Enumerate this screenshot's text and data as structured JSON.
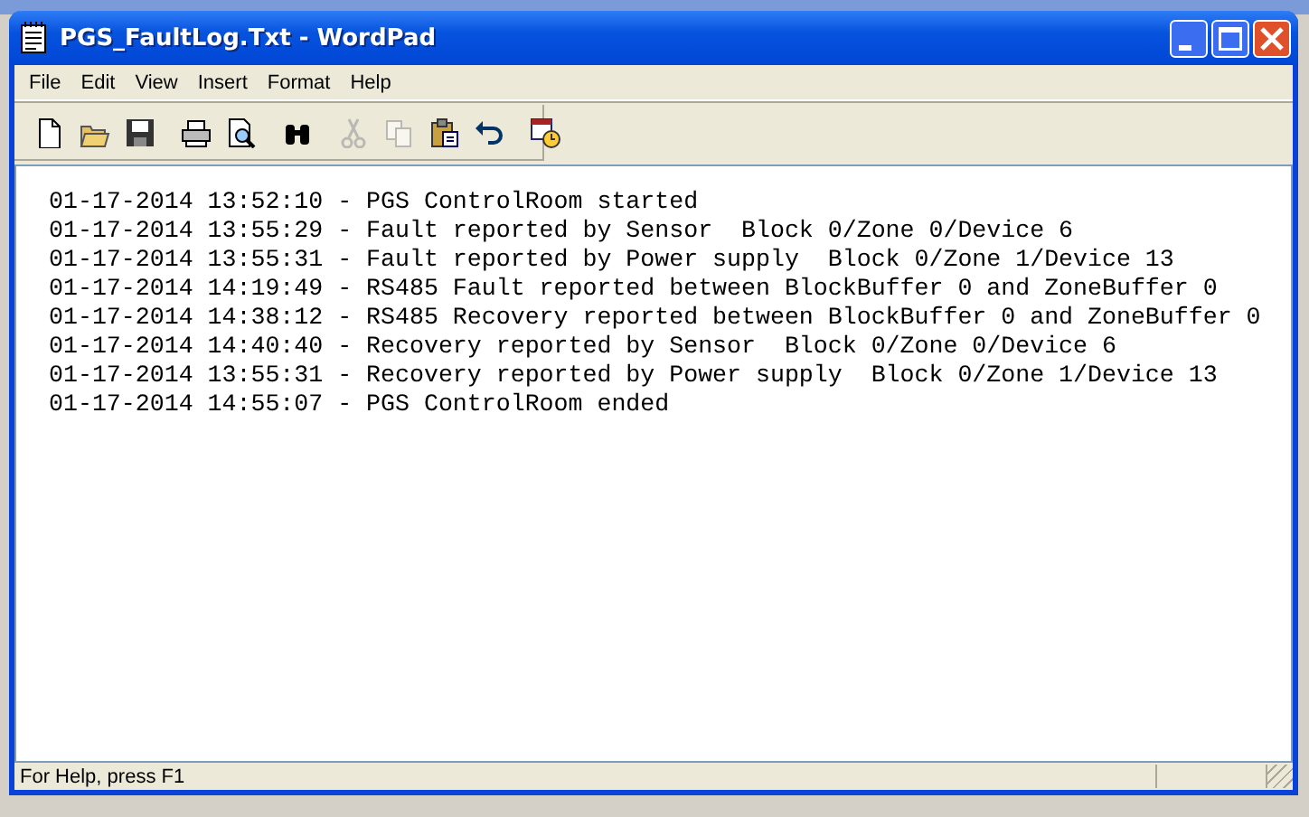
{
  "window": {
    "title": "PGS_FaultLog.Txt - WordPad"
  },
  "menu": [
    "File",
    "Edit",
    "View",
    "Insert",
    "Format",
    "Help"
  ],
  "toolbar": [
    {
      "kind": "new",
      "disabled": false
    },
    {
      "kind": "open",
      "disabled": false
    },
    {
      "kind": "save",
      "disabled": false
    },
    {
      "kind": "sep"
    },
    {
      "kind": "print",
      "disabled": false
    },
    {
      "kind": "preview",
      "disabled": false
    },
    {
      "kind": "sep"
    },
    {
      "kind": "find",
      "disabled": false
    },
    {
      "kind": "sep"
    },
    {
      "kind": "cut",
      "disabled": true
    },
    {
      "kind": "copy",
      "disabled": true
    },
    {
      "kind": "paste",
      "disabled": false
    },
    {
      "kind": "undo",
      "disabled": false
    },
    {
      "kind": "sep"
    },
    {
      "kind": "datetime",
      "disabled": false
    }
  ],
  "document": {
    "lines": [
      "01-17-2014 13:52:10 - PGS ControlRoom started",
      "01-17-2014 13:55:29 - Fault reported by Sensor  Block 0/Zone 0/Device 6",
      "01-17-2014 13:55:31 - Fault reported by Power supply  Block 0/Zone 1/Device 13",
      "01-17-2014 14:19:49 - RS485 Fault reported between BlockBuffer 0 and ZoneBuffer 0",
      "01-17-2014 14:38:12 - RS485 Recovery reported between BlockBuffer 0 and ZoneBuffer 0",
      "01-17-2014 14:40:40 - Recovery reported by Sensor  Block 0/Zone 0/Device 6",
      "01-17-2014 13:55:31 - Recovery reported by Power supply  Block 0/Zone 1/Device 13",
      "01-17-2014 14:55:07 - PGS ControlRoom ended"
    ]
  },
  "status_bar": "For Help, press F1"
}
